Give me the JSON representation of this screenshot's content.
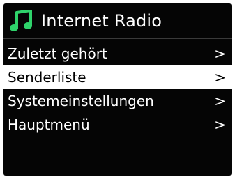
{
  "header": {
    "icon": "music-note-icon",
    "title": "Internet Radio",
    "accent_color": "#2fd36b"
  },
  "menu": {
    "items": [
      {
        "label": "Zuletzt gehört",
        "chevron": ">",
        "selected": false
      },
      {
        "label": "Senderliste",
        "chevron": ">",
        "selected": true
      },
      {
        "label": "Systemeinstellungen",
        "chevron": ">",
        "selected": false
      },
      {
        "label": "Hauptmenü",
        "chevron": ">",
        "selected": false
      }
    ]
  },
  "colors": {
    "screen_background": "#050505",
    "text": "#ffffff",
    "selected_background": "#ffffff",
    "selected_text": "#000000"
  }
}
